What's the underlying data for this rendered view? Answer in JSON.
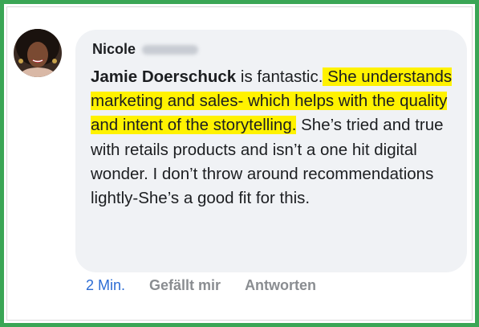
{
  "comment": {
    "author_first_name": "Nicole",
    "mention": "Jamie Doerschuck",
    "text_after_mention": " is fantastic.",
    "highlighted_text": " She understands marketing and sales- which helps with the quality and intent of the storytelling.",
    "text_rest": " She’s tried and true with retails products and isn’t a one hit digital wonder. I don’t throw around recommendations lightly-She’s a good fit for this."
  },
  "actions": {
    "time": "2 Min.",
    "like": "Gefällt mir",
    "reply": "Antworten"
  },
  "colors": {
    "frame_border": "#3aa655",
    "bubble_bg": "#f0f2f5",
    "highlight": "#fff200",
    "time_link": "#2c6cd4",
    "action_gray": "#8a8d91"
  }
}
